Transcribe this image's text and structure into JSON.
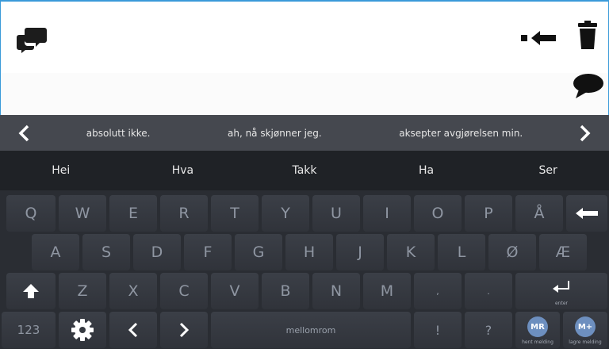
{
  "colors": {
    "accent_border": "#3a9ad9",
    "phrase_bar": "#45484f",
    "prediction_bar": "#1f2226",
    "key_bg": "#363a41",
    "key_text": "#8f96a2",
    "memory_button": "#6d8fbf"
  },
  "toolbar": {
    "chat_icon": "chat-bubbles-icon",
    "backspace_word_icon": "backspace-arrow-icon",
    "delete_icon": "trash-icon",
    "speak_icon": "speech-bubble-icon"
  },
  "phrases": {
    "prev_icon": "chevron-left-icon",
    "next_icon": "chevron-right-icon",
    "items": [
      "absolutt ikke.",
      "ah, nå skjønner jeg.",
      "aksepter avgjørelsen min."
    ]
  },
  "predictions": [
    "Hei",
    "Hva",
    "Takk",
    "Ha",
    "Ser"
  ],
  "keyboard": {
    "row1": [
      "Q",
      "W",
      "E",
      "R",
      "T",
      "Y",
      "U",
      "I",
      "O",
      "P",
      "Å"
    ],
    "row2": [
      "A",
      "S",
      "D",
      "F",
      "G",
      "H",
      "J",
      "K",
      "L",
      "Ø",
      "Æ"
    ],
    "row3": [
      "Z",
      "X",
      "C",
      "V",
      "B",
      "N",
      "M",
      ",",
      "."
    ],
    "enter_label": "enter",
    "numbers_label": "123",
    "space_label": "mellomrom",
    "exclaim": "!",
    "question": "?",
    "mr_label": "MR",
    "mr_caption": "hent melding",
    "mplus_label": "M+",
    "mplus_caption": "lagre melding"
  }
}
